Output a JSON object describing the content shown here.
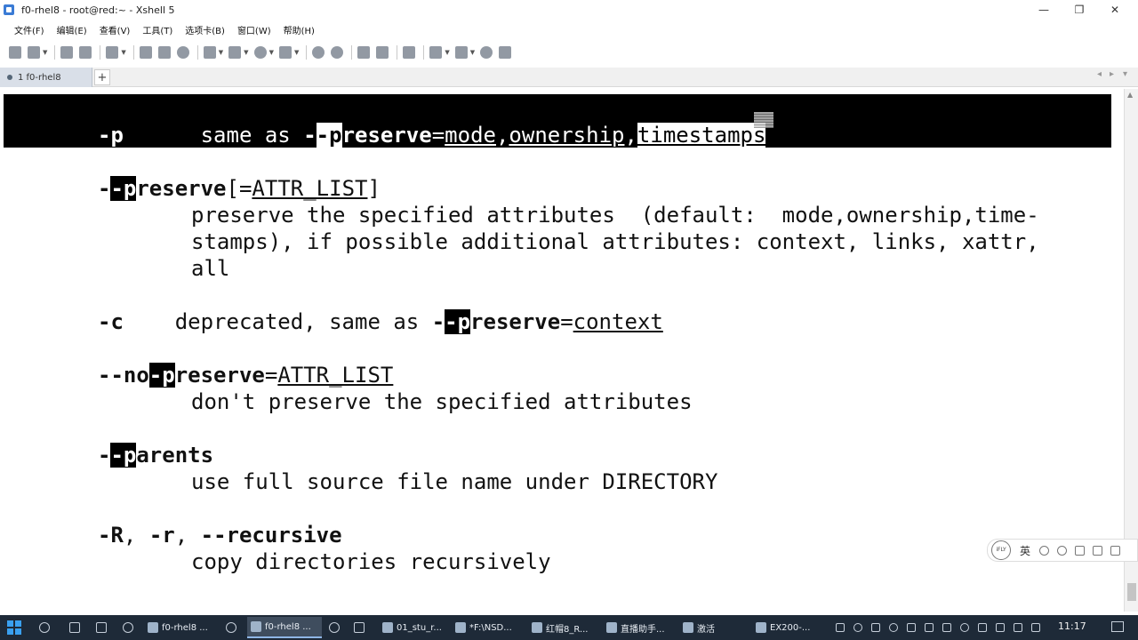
{
  "window": {
    "title": "f0-rhel8 - root@red:~ - Xshell 5",
    "controls": {
      "minimize": "—",
      "maximize": "❐",
      "close": "✕"
    }
  },
  "menu": [
    "文件(F)",
    "编辑(E)",
    "查看(V)",
    "工具(T)",
    "选项卡(B)",
    "窗口(W)",
    "帮助(H)"
  ],
  "tabs": {
    "session": "1 f0-rhel8",
    "add": "+",
    "prev": "◂",
    "next": "▸",
    "list": "▾"
  },
  "terminal": {
    "l1": {
      "flag": "-p",
      "same_as": "same as ",
      "dash1": "-",
      "dash2": "-",
      "p": "p",
      "reserve": "reserve",
      "eq": "=",
      "mode": "mode",
      "comma1": ",",
      "ownership": "ownership",
      "comma2": ",",
      "timestamps": "timestamps"
    },
    "l2": {
      "dash1": "-",
      "p": "-p",
      "reserve": "reserve",
      "bracket_open": "[=",
      "attr": "ATTR_LIST",
      "bracket_close": "]"
    },
    "l3": "preserve the specified attributes  (default:  mode,ownership,time-",
    "l4": "stamps), if possible additional attributes: context, links, xattr,",
    "l5": "all",
    "l6": {
      "flag": "-c",
      "text": "deprecated, same as ",
      "dash": "-",
      "p": "-p",
      "reserve": "reserve",
      "eq": "=",
      "context": "context"
    },
    "l7": {
      "no": "--no",
      "p": "-p",
      "reserve": "reserve",
      "eq": "=",
      "attr": "ATTR_LIST"
    },
    "l8": "don't preserve the specified attributes",
    "l9": {
      "dash": "-",
      "p": "-p",
      "arents": "arents"
    },
    "l10": "use full source file name under DIRECTORY",
    "l11": {
      "R": "-R",
      "sep1": ", ",
      "r": "-r",
      "sep2": ", ",
      "recursive": "--recursive"
    },
    "l12": "copy directories recursively"
  },
  "ime": {
    "logo": "iFLY",
    "lang": "英"
  },
  "taskbar": {
    "items": [
      "f0-rhel8 ...",
      "f0-rhel8 ...",
      "01_stu_r...",
      "*F:\\NSD...",
      "红帽8_R...",
      "直播助手...",
      "激活",
      "EX200-..."
    ],
    "time": "11:17"
  }
}
